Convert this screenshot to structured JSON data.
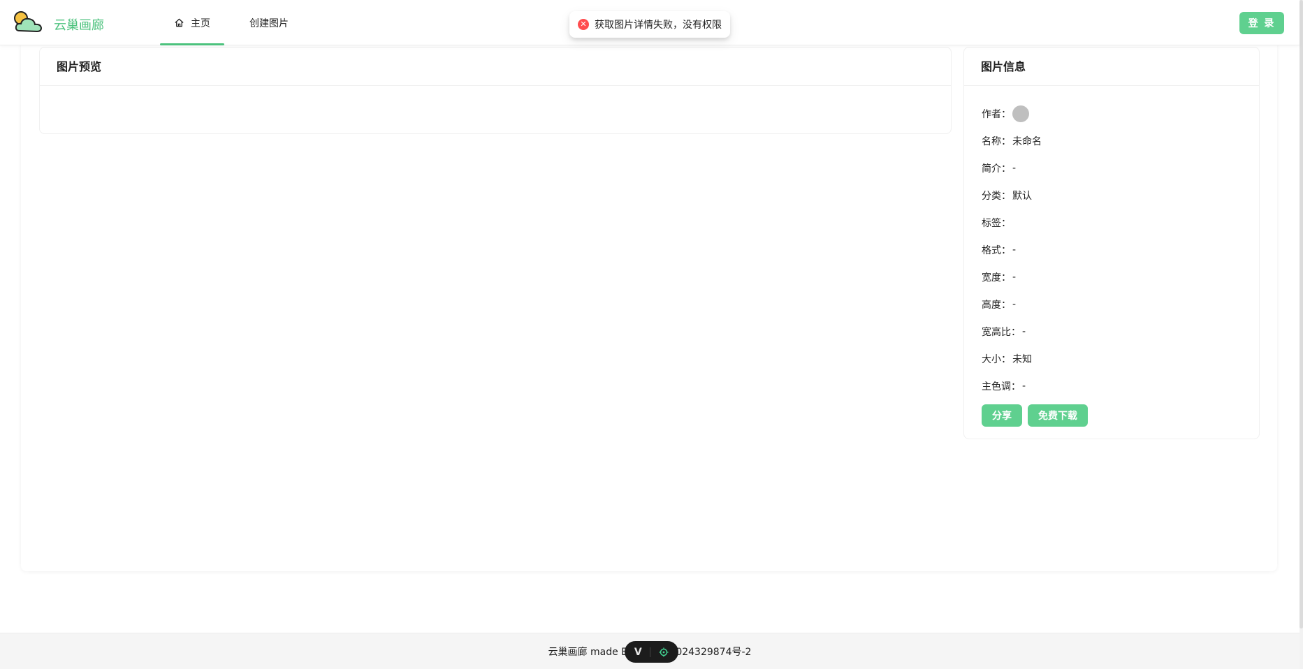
{
  "header": {
    "app_name": "云巢画廊",
    "nav": [
      {
        "label": "主页",
        "icon": "home-icon",
        "active": true
      },
      {
        "label": "创建图片",
        "active": false
      }
    ],
    "login_label": "登 录"
  },
  "toast": {
    "type": "error",
    "icon": "error-circle-icon",
    "message": "获取图片详情失败，没有权限"
  },
  "preview": {
    "title": "图片预览"
  },
  "info": {
    "title": "图片信息",
    "rows": [
      {
        "label": "作者：",
        "value": ""
      },
      {
        "label": "名称：",
        "value": "未命名"
      },
      {
        "label": "简介：",
        "value": "-"
      },
      {
        "label": "分类：",
        "value": "默认"
      },
      {
        "label": "标签：",
        "value": ""
      },
      {
        "label": "格式：",
        "value": "-"
      },
      {
        "label": "宽度：",
        "value": "-"
      },
      {
        "label": "高度：",
        "value": "-"
      },
      {
        "label": "宽高比：",
        "value": "-"
      },
      {
        "label": "大小：",
        "value": "未知"
      },
      {
        "label": "主色调：",
        "value": "-"
      }
    ],
    "share_label": "分享",
    "download_label": "免费下载"
  },
  "footer": {
    "text": "云巢画廊 made By：N                    P备2024329874号-2"
  },
  "colors": {
    "accent": "#4cc27d",
    "button": "#5fd08f",
    "error": "#ff4d4f",
    "footer_bg": "#f5f5f5"
  }
}
